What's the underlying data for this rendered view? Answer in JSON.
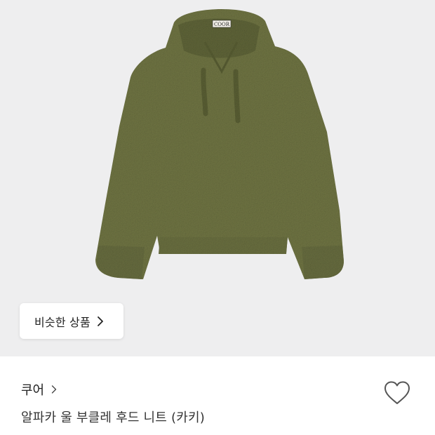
{
  "product_image": {
    "label_tag": "COOR",
    "colors": {
      "background": "#eeeeef",
      "knit": "#6f7443"
    }
  },
  "similar_button": {
    "label": "비슷한 상품"
  },
  "brand": {
    "name": "쿠어"
  },
  "product": {
    "name": "알파카 울 부클레 후드 니트 (카키)"
  },
  "icons": {
    "similar_chevron": "chevron-right-icon",
    "brand_chevron": "chevron-right-icon",
    "like": "heart-outline-icon"
  }
}
